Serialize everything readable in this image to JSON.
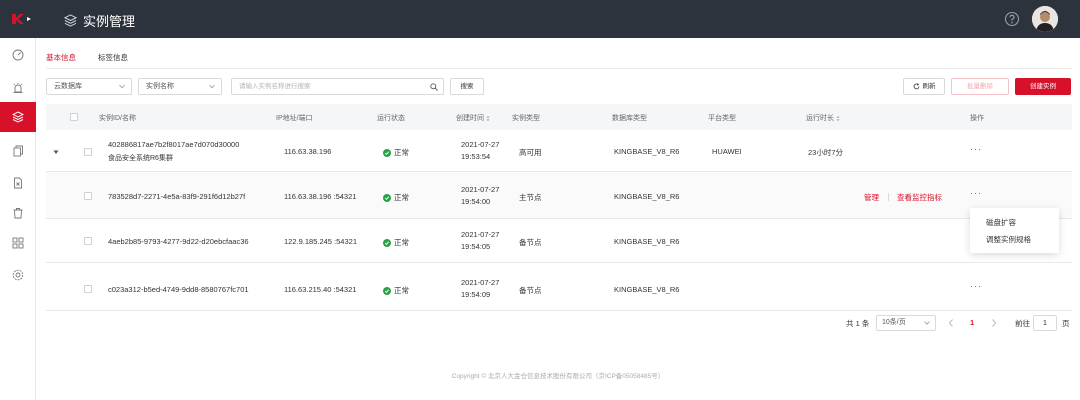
{
  "header": {
    "title": "实例管理",
    "brand_color": "#d7112a",
    "bar_color": "#2d333d",
    "logo_icon": "kingbase-logo-icon",
    "help_icon": "help-circle-icon"
  },
  "sidebar": {
    "items": [
      {
        "icon": "dashboard-icon",
        "active": false
      },
      {
        "icon": "alarm-icon",
        "active": false
      },
      {
        "icon": "layers-icon",
        "active": true
      },
      {
        "icon": "copy-icon",
        "active": false
      },
      {
        "icon": "file-icon",
        "active": false
      },
      {
        "icon": "trash-icon",
        "active": false
      },
      {
        "icon": "apps-grid-icon",
        "active": false
      },
      {
        "icon": "settings-icon",
        "active": false
      }
    ]
  },
  "tabs": [
    {
      "label": "基本信息",
      "active": true
    },
    {
      "label": "标签信息",
      "active": false
    }
  ],
  "toolbar": {
    "filter1": "云数据库",
    "filter2": "实例名称",
    "search_placeholder": "请输入实例名称进行搜索",
    "search_label": "搜索",
    "refresh_label": "刷新",
    "batch_delete_label": "批量删除",
    "create_label": "创建实例"
  },
  "table": {
    "headers": {
      "id_name": "实例ID/名称",
      "ip": "IP地址/端口",
      "status": "运行状态",
      "created": "创建时间",
      "instance_type": "实例类型",
      "db_type": "数据库类型",
      "platform": "平台类型",
      "uptime": "运行时长",
      "actions": "操作"
    },
    "rows": [
      {
        "id": "402886817ae7b2f8017ae7d070d30000",
        "name": "食品安全系统R6集群",
        "ip": "116.63.38.196",
        "status": "正常",
        "date": "2021-07-27",
        "time": "19:53:54",
        "instance_type": "高可用",
        "db_type": "KINGBASE_V8_R6",
        "platform": "HUAWEI",
        "uptime": "23小时7分",
        "more": "···"
      },
      {
        "id": "783528d7-2271-4e5a-83f9-291f6d12b27f",
        "ip": "116.63.38.196 :54321",
        "status": "正常",
        "date": "2021-07-27",
        "time": "19:54:00",
        "instance_type": "主节点",
        "db_type": "KINGBASE_V8_R6",
        "link_manage": "管理",
        "link_monitor": "查看监控指标",
        "more": "···"
      },
      {
        "id": "4aeb2b85-9793-4277-9d22-d20ebcfaac36",
        "ip": "122.9.185.245 :54321",
        "status": "正常",
        "date": "2021-07-27",
        "time": "19:54:05",
        "instance_type": "备节点",
        "db_type": "KINGBASE_V8_R6"
      },
      {
        "id": "c023a312-b5ed-4749-9dd8-8580767fc701",
        "ip": "116.63.215.40 :54321",
        "status": "正常",
        "date": "2021-07-27",
        "time": "19:54:09",
        "instance_type": "备节点",
        "db_type": "KINGBASE_V8_R6",
        "more": "···"
      }
    ]
  },
  "dropdown": {
    "items": [
      "磁盘扩容",
      "调整实例规格"
    ]
  },
  "pagination": {
    "total": "共 1 条",
    "page_size": "10条/页",
    "current": "1",
    "goto_label": "前往",
    "goto_value": "1",
    "page_suffix": "页"
  },
  "footer": {
    "copyright": "Copyright © 北京人大金仓信息技术股份有限公司（京ICP备05058485号）"
  },
  "status_color": "#2ba244"
}
